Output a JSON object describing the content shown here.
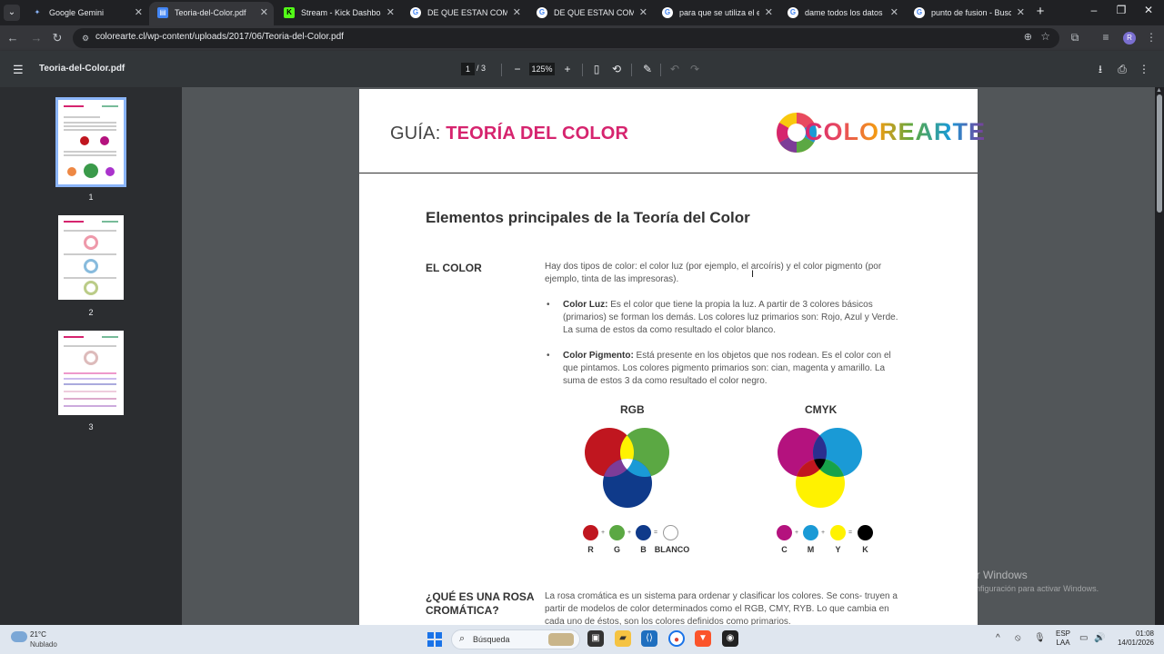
{
  "tabs": [
    {
      "label": "Google Gemini",
      "favicon": "gemini-icon",
      "color": "#8ab4f8"
    },
    {
      "label": "Teoria-del-Color.pdf",
      "favicon": "pdf-icon",
      "color": "#4285f4",
      "active": true
    },
    {
      "label": "Stream - Kick Dashboard",
      "favicon": "kick-icon",
      "color": "#53fc18"
    },
    {
      "label": "DE QUE ESTAN COMPUES",
      "favicon": "google-icon",
      "color": "#ffffff"
    },
    {
      "label": "DE QUE ESTAN COMPUES",
      "favicon": "google-icon",
      "color": "#ffffff"
    },
    {
      "label": "para que se utiliza el elem",
      "favicon": "google-icon",
      "color": "#ffffff"
    },
    {
      "label": "dame todos los datos del",
      "favicon": "google-icon",
      "color": "#ffffff"
    },
    {
      "label": "punto de fusion - Buscar",
      "favicon": "google-icon",
      "color": "#ffffff"
    }
  ],
  "address": {
    "url": "colorearte.cl/wp-content/uploads/2017/06/Teoria-del-Color.pdf"
  },
  "profile_initial": "R",
  "pdf_toolbar": {
    "title": "Teoria-del-Color.pdf",
    "current_page": "1",
    "total_pages": "3",
    "zoom": "125%"
  },
  "thumbnails": [
    {
      "num": "1"
    },
    {
      "num": "2"
    },
    {
      "num": "3"
    }
  ],
  "document": {
    "header_prefix": "GUÍA: ",
    "header_title": "TEORÍA DEL COLOR",
    "logo_text": "COLOREARTE",
    "heading": "Elementos principales de la Teoría del Color",
    "section1_label": "EL COLOR",
    "section1_intro": "Hay dos tipos de color: el color luz (por ejemplo, el arcoíris) y el color pigmento (por ejemplo, tinta de las impresoras).",
    "bullet1_title": "Color Luz:",
    "bullet1_text": " Es el color que tiene la propia la luz. A partir de 3 colores básicos (primarios) se forman los demás. Los colores luz primarios son: Rojo, Azul y Verde. La suma de estos da como resultado el color blanco.",
    "bullet2_title": "Color Pigmento:",
    "bullet2_text": " Está presente en los objetos que nos rodean. Es el color con el que pintamos. Los colores pigmento primarios son: cian, magenta y amarillo. La suma de estos 3 da como resultado el color negro.",
    "rgb_title": "RGB",
    "cmyk_title": "CMYK",
    "rgb_labels": [
      "R",
      "G",
      "B",
      "BLANCO"
    ],
    "cmyk_labels": [
      "C",
      "M",
      "Y",
      "K"
    ],
    "plus": "+",
    "equals": "=",
    "section2_label": "¿QUÉ ES UNA ROSA CROMÁTICA?",
    "section2_text": "La rosa cromática es un sistema para ordenar y clasificar los colores. Se cons- truyen a partir de modelos de color determinados como el RGB, CMY, RYB. Lo que cambia en cada uno de éstos, son los  colores definidos como primarios."
  },
  "colors": {
    "accent_pink": "#d6246e",
    "red": "#c0161f",
    "green": "#5ba843",
    "blue": "#0f3a8a",
    "cyan": "#1a9ad6",
    "magenta": "#b4127e",
    "yellow": "#fff200",
    "black": "#000000"
  },
  "watermark": {
    "line1": "Activar Windows",
    "line2": "Ve a Configuración para activar Windows."
  },
  "taskbar": {
    "temperature": "21°C",
    "condition": "Nublado",
    "search_placeholder": "Búsqueda",
    "lang_line1": "ESP",
    "lang_line2": "LAA",
    "time": "01:08",
    "date": "14/01/2026"
  }
}
